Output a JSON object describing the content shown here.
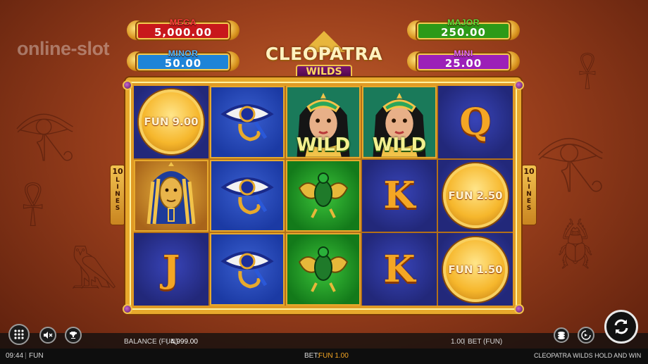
{
  "watermark": "online-slot",
  "jackpots": {
    "mega": {
      "label": "MEGA",
      "value": "5,000.00",
      "color": "#c8181c",
      "label_color": "#ff3b3b"
    },
    "minor": {
      "label": "MINOR",
      "value": "50.00",
      "color": "#1e84d8",
      "label_color": "#4fb6ff"
    },
    "major": {
      "label": "MAJOR",
      "value": "250.00",
      "color": "#2d9a18",
      "label_color": "#5fe03a"
    },
    "mini": {
      "label": "MINI",
      "value": "25.00",
      "color": "#9c20b8",
      "label_color": "#e36cff"
    }
  },
  "title": {
    "line1": "CLEOPATRA",
    "line2": "WILDS"
  },
  "lines_left": {
    "number": "10",
    "word": "LINES"
  },
  "lines_right": {
    "number": "10",
    "word": "LINES"
  },
  "reels": [
    [
      {
        "type": "coin",
        "text": "FUN 9.00"
      },
      {
        "type": "pharaoh",
        "icon": "pharaoh-mask-icon"
      },
      {
        "type": "letter",
        "text": "J"
      }
    ],
    [
      {
        "type": "eye",
        "icon": "eye-of-horus-icon"
      },
      {
        "type": "eye",
        "icon": "eye-of-horus-icon"
      },
      {
        "type": "eye",
        "icon": "eye-of-horus-icon"
      }
    ],
    [
      {
        "type": "wild",
        "text": "WILD",
        "icon": "cleopatra-icon"
      },
      {
        "type": "scarab",
        "icon": "scarab-icon"
      },
      {
        "type": "scarab",
        "icon": "scarab-icon"
      }
    ],
    [
      {
        "type": "wild",
        "text": "WILD",
        "icon": "cleopatra-icon"
      },
      {
        "type": "letter",
        "text": "K"
      },
      {
        "type": "letter",
        "text": "K"
      }
    ],
    [
      {
        "type": "letter",
        "text": "Q"
      },
      {
        "type": "coin",
        "text": "FUN 2.50"
      },
      {
        "type": "coin",
        "text": "FUN 1.50"
      }
    ]
  ],
  "bottom": {
    "balance_label": "BALANCE (FUN)",
    "balance_value": "4,999.00",
    "bet_label": "BET:",
    "bet_value": "FUN 1.00",
    "bet_right_value": "1.00",
    "bet_right_label": "BET (FUN)",
    "clock": "09:44",
    "currency": "FUN",
    "game_name": "CLEOPATRA WILDS HOLD AND WIN"
  }
}
